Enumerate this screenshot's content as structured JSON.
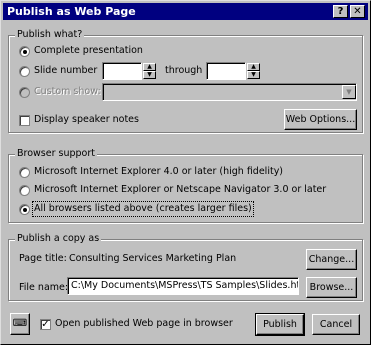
{
  "window": {
    "title": "Publish as Web Page",
    "help_label": "?",
    "close_label": "✕"
  },
  "publish_what": {
    "legend": "Publish what?",
    "complete_presentation": "Complete presentation",
    "slide_number": "Slide number",
    "through": "through",
    "slide_from": "",
    "slide_to": "",
    "custom_show": "Custom show:",
    "custom_show_value": "",
    "display_speaker_notes": "Display speaker notes",
    "display_speaker_notes_checked": false,
    "web_options": "Web Options..."
  },
  "browser_support": {
    "legend": "Browser support",
    "option1": "Microsoft Internet Explorer 4.0 or later (high fidelity)",
    "option2": "Microsoft Internet Explorer or Netscape Navigator 3.0 or later",
    "option3": "All browsers listed above (creates larger files)"
  },
  "publish_copy": {
    "legend": "Publish a copy as",
    "page_title_label": "Page title:",
    "page_title_value": "Consulting Services Marketing Plan",
    "change_button": "Change...",
    "file_name_label": "File name:",
    "file_name_value": "C:\\My Documents\\MSPress\\TS Samples\\Slides.htm",
    "browse_button": "Browse..."
  },
  "footer": {
    "office_assistant_icon": "office-assistant-icon",
    "open_in_browser": "Open published Web page in browser",
    "open_in_browser_checked": true,
    "publish_button": "Publish",
    "cancel_button": "Cancel"
  }
}
